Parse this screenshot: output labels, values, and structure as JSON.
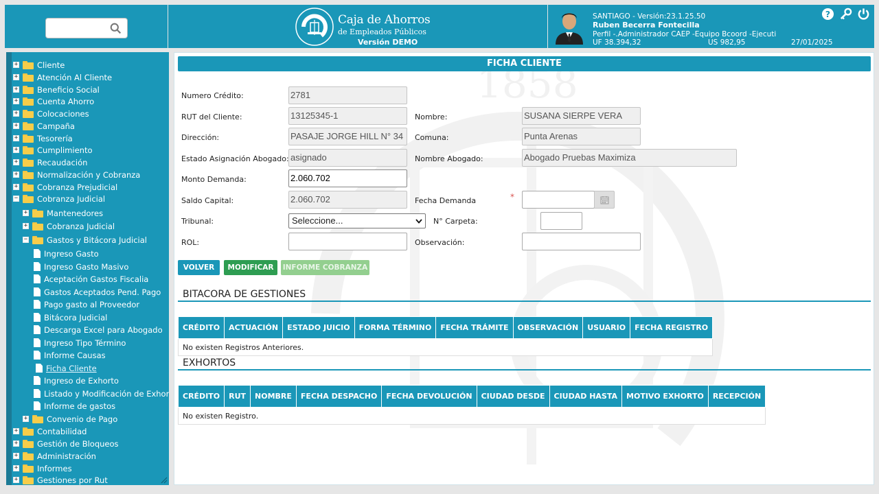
{
  "header": {
    "search": {
      "value": "",
      "placeholder": ""
    },
    "logo": {
      "line1": "Caja de Ahorros",
      "line2": "de Empleados Públicos",
      "version": "Versión DEMO"
    },
    "user": {
      "location_version": "SANTIAGO - Versión:23.1.25.50",
      "name": "Ruben Becerra Fontecilla",
      "profile": "Perfil -.Administrador CAEP -Equipo Bcoord -Ejecuti",
      "uf": "UF 38.394,32",
      "us": "US 982,95",
      "date": "27/01/2025"
    },
    "icons": [
      "help-icon",
      "key-icon",
      "power-icon"
    ]
  },
  "sidebar": {
    "top": [
      "Cliente",
      "Atención Al Cliente",
      "Beneficio Social",
      "Cuenta Ahorro",
      "Colocaciones",
      "Campaña",
      "Tesorería",
      "Cumplimiento",
      "Recaudación",
      "Normalización y Cobranza",
      "Cobranza Prejudicial",
      "Cobranza Judicial"
    ],
    "cj_children": [
      "Mantenedores",
      "Cobranza Judicial",
      "Gastos y Bitácora Judicial"
    ],
    "gastos_children": [
      "Ingreso Gasto",
      "Ingreso Gasto Masivo",
      "Aceptación Gastos Fiscalia",
      "Gastos Aceptados Pend. Pago",
      "Pago gasto al Proveedor",
      "Bitácora Judicial",
      "Descarga Excel para Abogado",
      "Ingreso Tipo Término",
      "Informe Causas",
      "Ficha Cliente",
      "Ingreso de Exhorto",
      "Listado y Modificación de Exhortos",
      "Informe de gastos"
    ],
    "convenio": "Convenio de Pago",
    "bottom": [
      "Contabilidad",
      "Gestión de Bloqueos",
      "Administración",
      "Informes",
      "Gestiones por Rut"
    ]
  },
  "form": {
    "title": "FICHA CLIENTE",
    "labels": {
      "numero_credito": "Numero Crédito:",
      "rut": "RUT del Cliente:",
      "nombre": "Nombre:",
      "direccion": "Dirección:",
      "comuna": "Comuna:",
      "estado_abogado": "Estado Asignación Abogado:",
      "nombre_abogado": "Nombre Abogado:",
      "monto_demanda": "Monto Demanda:",
      "saldo_capital": "Saldo Capital:",
      "fecha_demanda": "Fecha Demanda",
      "tribunal": "Tribunal:",
      "carpeta": "N° Carpeta:",
      "rol": "ROL:",
      "observacion": "Observación:"
    },
    "values": {
      "numero_credito": "2781",
      "rut": "13125345-1",
      "nombre": "SUSANA SIERPE VERA",
      "direccion": "PASAJE JORGE HILL N° 34",
      "comuna": "Punta Arenas",
      "estado_abogado": "asignado",
      "nombre_abogado": "Abogado Pruebas  Maximiza",
      "monto_demanda": "2.060.702",
      "saldo_capital": "2.060.702",
      "fecha_demanda": "",
      "tribunal": "Seleccione...",
      "carpeta": "",
      "rol": "",
      "observacion": ""
    },
    "required_mark": "*",
    "buttons": {
      "volver": "VOLVER",
      "modificar": "MODIFICAR",
      "informe": "INFORME COBRANZA"
    }
  },
  "bitacora": {
    "title": "BITACORA DE GESTIONES",
    "columns": [
      "CRÉDITO",
      "ACTUACIÓN",
      "ESTADO JUICIO",
      "FORMA TÉRMINO",
      "FECHA TRÁMITE",
      "OBSERVACIÓN",
      "USUARIO",
      "FECHA REGISTRO"
    ],
    "empty": "No existen Registros Anteriores."
  },
  "exhortos": {
    "title": "EXHORTOS",
    "columns": [
      "CRÉDITO",
      "RUT",
      "NOMBRE",
      "FECHA DESPACHO",
      "FECHA DEVOLUCIÓN",
      "CIUDAD DESDE",
      "CIUDAD HASTA",
      "MOTIVO EXHORTO",
      "RECEPCIÓN"
    ],
    "empty": "No existen Registro."
  },
  "colors": {
    "primary": "#1a97b8",
    "green": "#2e9d52",
    "light_green": "#93cf8f"
  }
}
